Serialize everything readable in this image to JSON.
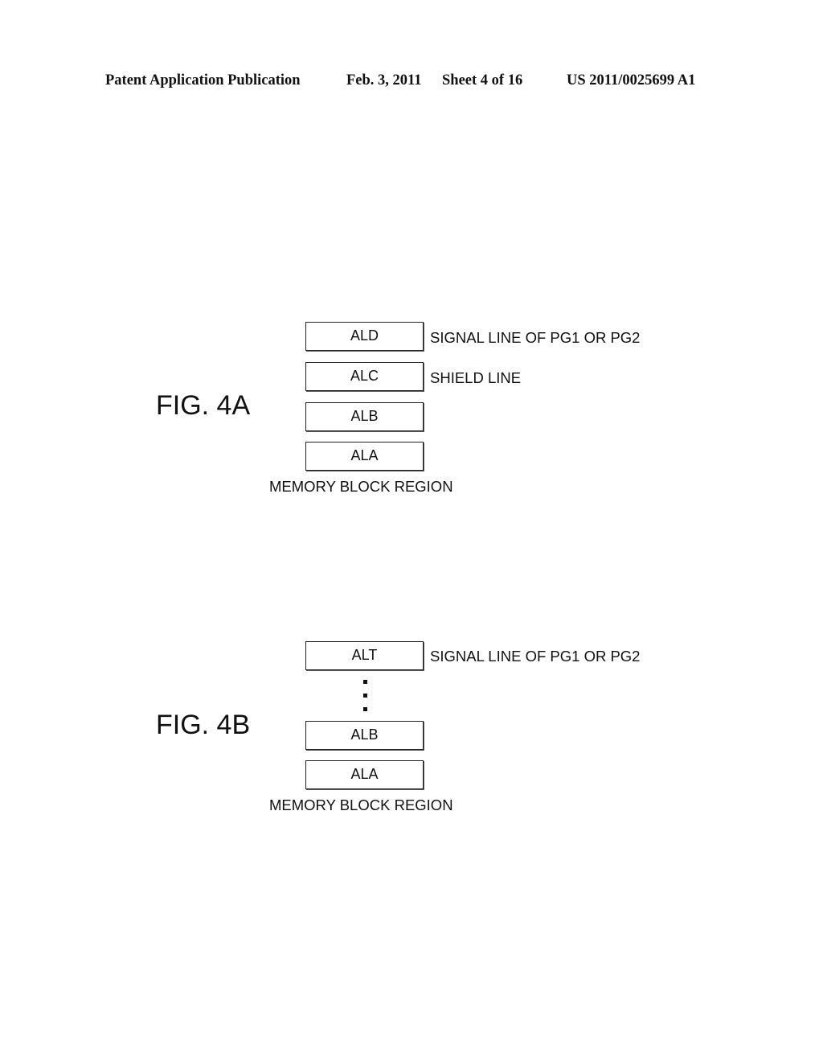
{
  "header": {
    "publication": "Patent Application Publication",
    "date": "Feb. 3, 2011",
    "sheet": "Sheet 4 of 16",
    "number": "US 2011/0025699 A1"
  },
  "figures": [
    {
      "label": "FIG. 4A",
      "blocks": [
        "ALD",
        "ALC",
        "ALB",
        "ALA"
      ],
      "side_labels": [
        "SIGNAL LINE OF PG1 OR PG2",
        "SHIELD LINE"
      ],
      "region_label": "MEMORY BLOCK REGION"
    },
    {
      "label": "FIG. 4B",
      "blocks": [
        "ALT",
        "ALB",
        "ALA"
      ],
      "side_labels": [
        "SIGNAL LINE OF PG1 OR PG2"
      ],
      "ellipsis": "vertical-dots",
      "region_label": "MEMORY BLOCK REGION"
    }
  ]
}
